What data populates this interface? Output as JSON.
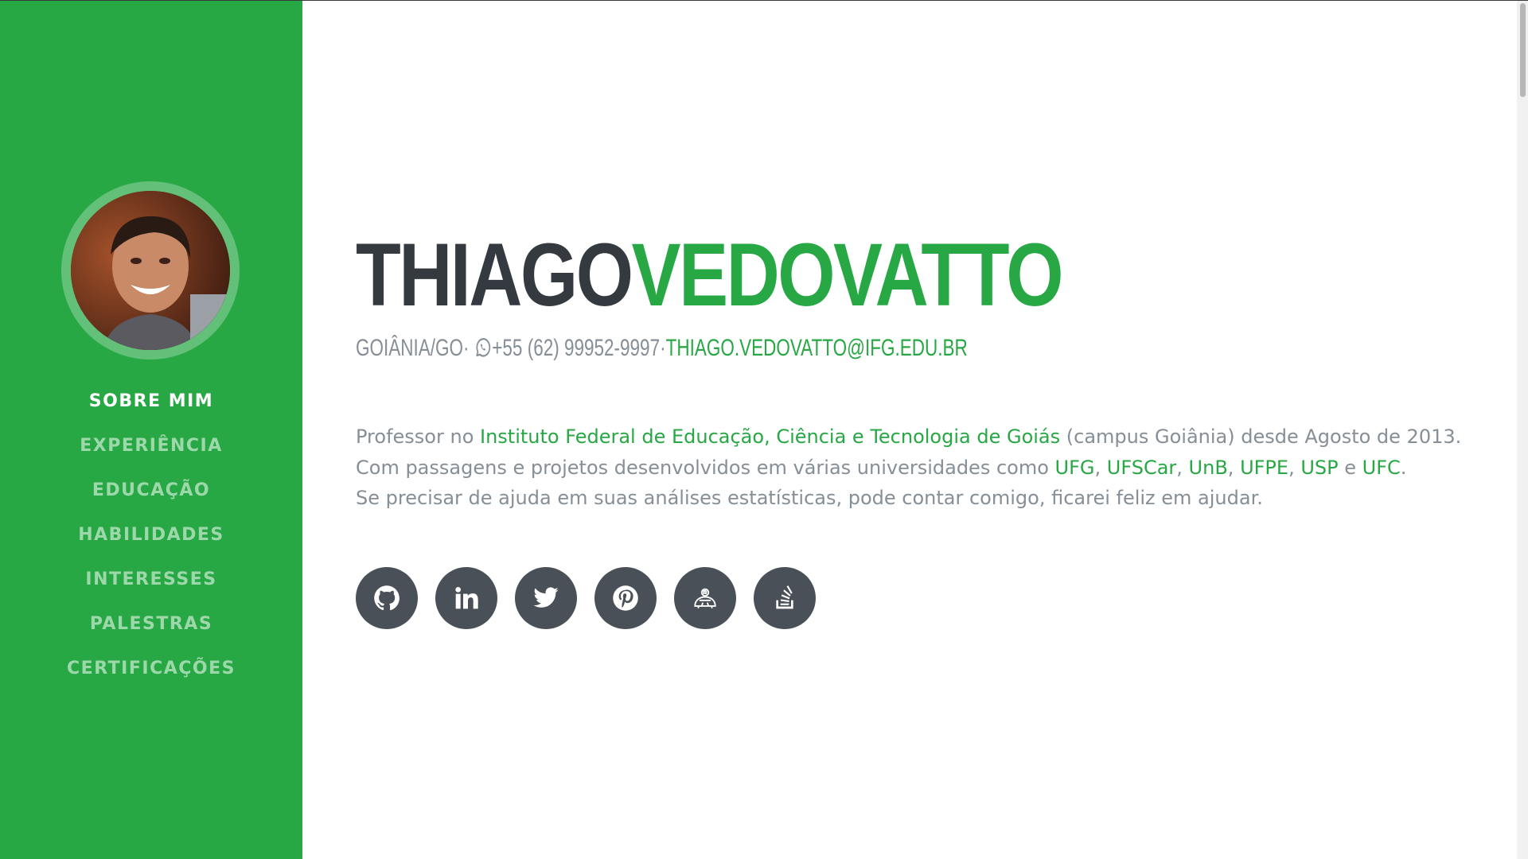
{
  "sidebar": {
    "avatar_alt": "profile photo",
    "nav": [
      {
        "label": "SOBRE MIM",
        "active": true
      },
      {
        "label": "EXPERIÊNCIA",
        "active": false
      },
      {
        "label": "EDUCAÇÃO",
        "active": false
      },
      {
        "label": "HABILIDADES",
        "active": false
      },
      {
        "label": "INTERESSES",
        "active": false
      },
      {
        "label": "PALESTRAS",
        "active": false
      },
      {
        "label": "CERTIFICAÇÕES",
        "active": false
      }
    ]
  },
  "header": {
    "first_name": "THIAGO",
    "last_name": "VEDOVATTO",
    "location": "GOIÂNIA/GO",
    "separator": "·",
    "phone": "+55 (62) 99952-9997",
    "email": "THIAGO.VEDOVATTO@IFG.EDU.BR"
  },
  "about": {
    "line1_pre": "Professor no ",
    "line1_link": "Instituto Federal de Educação, Ciência e Tecnologia de Goiás",
    "line1_post": " (campus Goiânia) desde Agosto de 2013.",
    "line2_pre": "Com passagens e projetos desenvolvidos em várias universidades como ",
    "line2_links": [
      "UFG",
      "UFSCar",
      "UnB",
      "UFPE",
      "USP",
      "UFC"
    ],
    "line2_sep": ", ",
    "line2_and": " e ",
    "line2_end": ".",
    "line3": "Se precisar de ajuda em suas análises estatísticas, pode contar comigo, ficarei feliz em ajudar."
  },
  "social": [
    {
      "icon": "github-icon"
    },
    {
      "icon": "linkedin-icon"
    },
    {
      "icon": "twitter-icon"
    },
    {
      "icon": "pinterest-icon"
    },
    {
      "icon": "r-package-icon"
    },
    {
      "icon": "stackoverflow-icon"
    }
  ],
  "colors": {
    "brand_green": "#27a844",
    "dark": "#343a40",
    "muted": "#868e96",
    "social_bg": "#495057"
  }
}
